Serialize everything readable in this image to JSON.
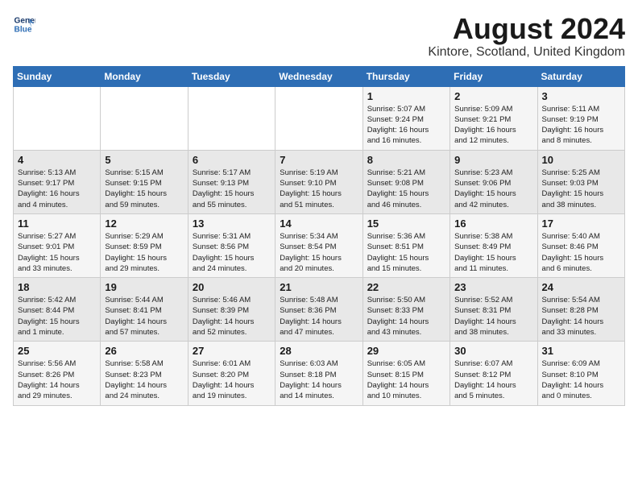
{
  "header": {
    "logo_line1": "General",
    "logo_line2": "Blue",
    "month_title": "August 2024",
    "location": "Kintore, Scotland, United Kingdom"
  },
  "days_of_week": [
    "Sunday",
    "Monday",
    "Tuesday",
    "Wednesday",
    "Thursday",
    "Friday",
    "Saturday"
  ],
  "weeks": [
    [
      {
        "day": "",
        "info": ""
      },
      {
        "day": "",
        "info": ""
      },
      {
        "day": "",
        "info": ""
      },
      {
        "day": "",
        "info": ""
      },
      {
        "day": "1",
        "info": "Sunrise: 5:07 AM\nSunset: 9:24 PM\nDaylight: 16 hours\nand 16 minutes."
      },
      {
        "day": "2",
        "info": "Sunrise: 5:09 AM\nSunset: 9:21 PM\nDaylight: 16 hours\nand 12 minutes."
      },
      {
        "day": "3",
        "info": "Sunrise: 5:11 AM\nSunset: 9:19 PM\nDaylight: 16 hours\nand 8 minutes."
      }
    ],
    [
      {
        "day": "4",
        "info": "Sunrise: 5:13 AM\nSunset: 9:17 PM\nDaylight: 16 hours\nand 4 minutes."
      },
      {
        "day": "5",
        "info": "Sunrise: 5:15 AM\nSunset: 9:15 PM\nDaylight: 15 hours\nand 59 minutes."
      },
      {
        "day": "6",
        "info": "Sunrise: 5:17 AM\nSunset: 9:13 PM\nDaylight: 15 hours\nand 55 minutes."
      },
      {
        "day": "7",
        "info": "Sunrise: 5:19 AM\nSunset: 9:10 PM\nDaylight: 15 hours\nand 51 minutes."
      },
      {
        "day": "8",
        "info": "Sunrise: 5:21 AM\nSunset: 9:08 PM\nDaylight: 15 hours\nand 46 minutes."
      },
      {
        "day": "9",
        "info": "Sunrise: 5:23 AM\nSunset: 9:06 PM\nDaylight: 15 hours\nand 42 minutes."
      },
      {
        "day": "10",
        "info": "Sunrise: 5:25 AM\nSunset: 9:03 PM\nDaylight: 15 hours\nand 38 minutes."
      }
    ],
    [
      {
        "day": "11",
        "info": "Sunrise: 5:27 AM\nSunset: 9:01 PM\nDaylight: 15 hours\nand 33 minutes."
      },
      {
        "day": "12",
        "info": "Sunrise: 5:29 AM\nSunset: 8:59 PM\nDaylight: 15 hours\nand 29 minutes."
      },
      {
        "day": "13",
        "info": "Sunrise: 5:31 AM\nSunset: 8:56 PM\nDaylight: 15 hours\nand 24 minutes."
      },
      {
        "day": "14",
        "info": "Sunrise: 5:34 AM\nSunset: 8:54 PM\nDaylight: 15 hours\nand 20 minutes."
      },
      {
        "day": "15",
        "info": "Sunrise: 5:36 AM\nSunset: 8:51 PM\nDaylight: 15 hours\nand 15 minutes."
      },
      {
        "day": "16",
        "info": "Sunrise: 5:38 AM\nSunset: 8:49 PM\nDaylight: 15 hours\nand 11 minutes."
      },
      {
        "day": "17",
        "info": "Sunrise: 5:40 AM\nSunset: 8:46 PM\nDaylight: 15 hours\nand 6 minutes."
      }
    ],
    [
      {
        "day": "18",
        "info": "Sunrise: 5:42 AM\nSunset: 8:44 PM\nDaylight: 15 hours\nand 1 minute."
      },
      {
        "day": "19",
        "info": "Sunrise: 5:44 AM\nSunset: 8:41 PM\nDaylight: 14 hours\nand 57 minutes."
      },
      {
        "day": "20",
        "info": "Sunrise: 5:46 AM\nSunset: 8:39 PM\nDaylight: 14 hours\nand 52 minutes."
      },
      {
        "day": "21",
        "info": "Sunrise: 5:48 AM\nSunset: 8:36 PM\nDaylight: 14 hours\nand 47 minutes."
      },
      {
        "day": "22",
        "info": "Sunrise: 5:50 AM\nSunset: 8:33 PM\nDaylight: 14 hours\nand 43 minutes."
      },
      {
        "day": "23",
        "info": "Sunrise: 5:52 AM\nSunset: 8:31 PM\nDaylight: 14 hours\nand 38 minutes."
      },
      {
        "day": "24",
        "info": "Sunrise: 5:54 AM\nSunset: 8:28 PM\nDaylight: 14 hours\nand 33 minutes."
      }
    ],
    [
      {
        "day": "25",
        "info": "Sunrise: 5:56 AM\nSunset: 8:26 PM\nDaylight: 14 hours\nand 29 minutes."
      },
      {
        "day": "26",
        "info": "Sunrise: 5:58 AM\nSunset: 8:23 PM\nDaylight: 14 hours\nand 24 minutes."
      },
      {
        "day": "27",
        "info": "Sunrise: 6:01 AM\nSunset: 8:20 PM\nDaylight: 14 hours\nand 19 minutes."
      },
      {
        "day": "28",
        "info": "Sunrise: 6:03 AM\nSunset: 8:18 PM\nDaylight: 14 hours\nand 14 minutes."
      },
      {
        "day": "29",
        "info": "Sunrise: 6:05 AM\nSunset: 8:15 PM\nDaylight: 14 hours\nand 10 minutes."
      },
      {
        "day": "30",
        "info": "Sunrise: 6:07 AM\nSunset: 8:12 PM\nDaylight: 14 hours\nand 5 minutes."
      },
      {
        "day": "31",
        "info": "Sunrise: 6:09 AM\nSunset: 8:10 PM\nDaylight: 14 hours\nand 0 minutes."
      }
    ]
  ]
}
